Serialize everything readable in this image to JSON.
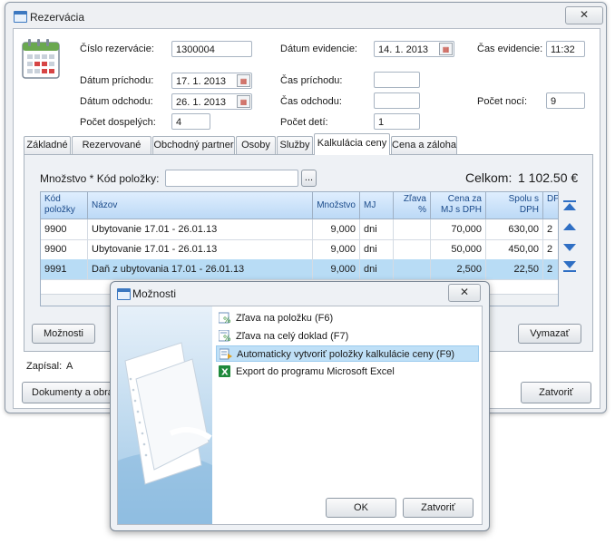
{
  "main_window": {
    "title": "Rezervácia",
    "close_glyph": "✕",
    "header_icon": "calendar-icon",
    "fields": {
      "cislo_rezervacie": {
        "label": "Číslo rezervácie:",
        "value": "1300004"
      },
      "datum_evidencie": {
        "label": "Dátum evidencie:",
        "value": "14. 1. 2013"
      },
      "cas_evidencie": {
        "label": "Čas evidencie:",
        "value": "11:32"
      },
      "datum_prichodu": {
        "label": "Dátum príchodu:",
        "value": "17. 1. 2013"
      },
      "cas_prichodu": {
        "label": "Čas príchodu:",
        "value": ""
      },
      "datum_odchodu": {
        "label": "Dátum odchodu:",
        "value": "26. 1. 2013"
      },
      "cas_odchodu": {
        "label": "Čas odchodu:",
        "value": ""
      },
      "pocet_noci": {
        "label": "Počet nocí:",
        "value": "9"
      },
      "pocet_dospelych": {
        "label": "Počet dospelých:",
        "value": "4"
      },
      "pocet_deti": {
        "label": "Počet detí:",
        "value": "1"
      }
    },
    "tabs": [
      {
        "label": "Základné"
      },
      {
        "label": "Rezervované izby"
      },
      {
        "label": "Obchodný partner"
      },
      {
        "label": "Osoby"
      },
      {
        "label": "Služby"
      },
      {
        "label": "Kalkulácia ceny"
      },
      {
        "label": "Cena a záloha"
      }
    ],
    "active_tab": "Kalkulácia ceny",
    "kalkulacia": {
      "mnozstvo_label": "Množstvo * Kód položky:",
      "kod_value": "",
      "browse_label": "...",
      "celkom_label": "Celkom:",
      "celkom_value": "1 102.50 €",
      "columns": [
        "Kód položky",
        "Názov",
        "Množstvo",
        "MJ",
        "Zľava %",
        "Cena za MJ s DPH",
        "Spolu s DPH",
        "DP"
      ],
      "rows": [
        {
          "kod": "9900",
          "nazov": "Ubytovanie  17.01 - 26.01.13",
          "mnozstvo": "9,000",
          "mj": "dni",
          "zlava": "",
          "cena": "70,000",
          "spolu": "630,00",
          "dph": "2"
        },
        {
          "kod": "9900",
          "nazov": "Ubytovanie  17.01 - 26.01.13",
          "mnozstvo": "9,000",
          "mj": "dni",
          "zlava": "",
          "cena": "50,000",
          "spolu": "450,00",
          "dph": "2"
        },
        {
          "kod": "9991",
          "nazov": "Daň z ubytovania  17.01 - 26.01.13",
          "mnozstvo": "9,000",
          "mj": "dni",
          "zlava": "",
          "cena": "2,500",
          "spolu": "22,50",
          "dph": "2"
        }
      ],
      "selected_row": 2,
      "buttons": {
        "moznosti": "Možnosti",
        "vymazat": "Vymazať"
      }
    },
    "zapisal_label": "Zapísal:",
    "zapisal_value": "A",
    "bottom_buttons": {
      "dokumenty": "Dokumenty a obrá",
      "zatvorit": "Zatvoriť"
    },
    "colors": {
      "accent": "#3c78c0",
      "selection": "#b8dcf5",
      "grid_header": "#bcd9f6"
    }
  },
  "dialog": {
    "title": "Možnosti",
    "close_glyph": "✕",
    "items": [
      {
        "label": "Zľava na položku (F6)",
        "icon": "discount-item-icon"
      },
      {
        "label": "Zľava na celý doklad (F7)",
        "icon": "discount-document-icon"
      },
      {
        "label": "Automaticky vytvoriť položky kalkulácie ceny (F9)",
        "icon": "auto-create-icon"
      },
      {
        "label": "Export do programu Microsoft Excel",
        "icon": "excel-icon"
      }
    ],
    "highlighted_item": 2,
    "ok_label": "OK",
    "close_label": "Zatvoriť"
  }
}
